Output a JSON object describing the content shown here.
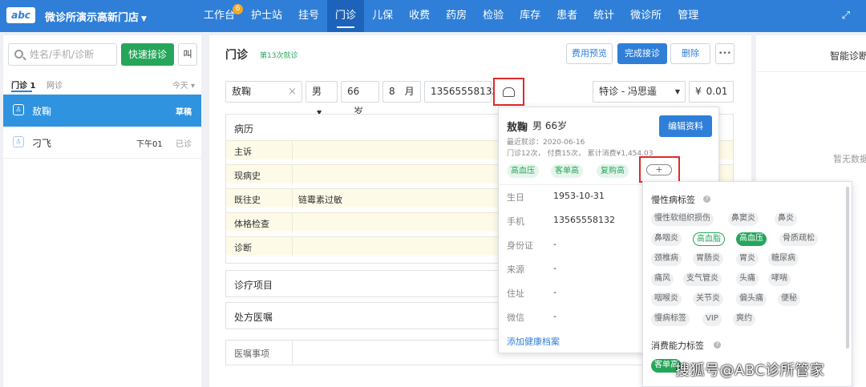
{
  "topbar": {
    "logo": "abc",
    "clinic_name": "微诊所演示高新门店",
    "nav": [
      {
        "label": "工作台",
        "badge": "6"
      },
      {
        "label": "护士站"
      },
      {
        "label": "挂号"
      },
      {
        "label": "门诊",
        "active": true
      },
      {
        "label": "儿保"
      },
      {
        "label": "收费"
      },
      {
        "label": "药房"
      },
      {
        "label": "检验"
      },
      {
        "label": "库存"
      },
      {
        "label": "患者"
      },
      {
        "label": "统计"
      },
      {
        "label": "微诊所"
      },
      {
        "label": "管理"
      }
    ],
    "expand_icon": "expand-icon"
  },
  "left": {
    "search_placeholder": "姓名/手机/诊断",
    "quick_btn": "快速接诊",
    "call_btn": "叫",
    "tab_clinic": "门诊 1",
    "tab_online": "网诊",
    "today": "今天 ▾",
    "patients": [
      {
        "name": "敖鞠",
        "time": "",
        "status": "草稿",
        "selected": true
      },
      {
        "name": "刁飞",
        "time": "下午01",
        "status": "已诊"
      }
    ]
  },
  "main": {
    "title": "门诊",
    "subtitle": "第13次就诊",
    "btn_fee": "费用预览",
    "btn_done": "完成接诊",
    "btn_delete": "删除",
    "btn_more": "•••",
    "patient_name": "敖鞠",
    "gender": "男",
    "age_years": "66",
    "unit_years": "岁",
    "age_months": "8",
    "unit_months": "月",
    "phone": "13565558132",
    "doctor": "特诊 - 冯思遥",
    "fee_symbol": "¥",
    "fee": "0.01",
    "medical_record": {
      "title": "病历",
      "rows": [
        {
          "label": "主诉",
          "value": ""
        },
        {
          "label": "现病史",
          "value": ""
        },
        {
          "label": "既往史",
          "value": "链霉素过敏"
        },
        {
          "label": "体格检查",
          "value": ""
        },
        {
          "label": "诊断",
          "value": ""
        }
      ]
    },
    "treatment_title": "诊疗项目",
    "prescription_title": "处方医嘱",
    "advice_label": "医嘱事项"
  },
  "right": {
    "title": "智能诊断",
    "empty": "暂无数据"
  },
  "popup": {
    "name": "敖鞠",
    "gender_age": "男 66岁",
    "edit_btn": "编辑资料",
    "last_visit": "最近就诊：2020-06-16",
    "stats": "门诊12次，  付费15次，   累计消费¥1,454.03",
    "tags": [
      "高血压",
      "客单高",
      "复购高"
    ],
    "plus": "+",
    "fields": [
      {
        "label": "生日",
        "value": "1953-10-31"
      },
      {
        "label": "手机",
        "value": "13565558132"
      },
      {
        "label": "身份证",
        "value": "-"
      },
      {
        "label": "来源",
        "value": "-"
      },
      {
        "label": "住址",
        "value": "-"
      },
      {
        "label": "微信",
        "value": "-"
      }
    ],
    "add_record": "添加健康档案"
  },
  "tag_panel": {
    "chronic_title": "慢性病标签",
    "chronic_tags": [
      {
        "label": "慢性软组织损伤"
      },
      {
        "label": "鼻窦炎"
      },
      {
        "label": "鼻炎"
      },
      {
        "label": "鼻咽炎"
      },
      {
        "label": "高血脂",
        "state": "outline"
      },
      {
        "label": "高血压",
        "state": "filled"
      },
      {
        "label": "骨质疏松"
      },
      {
        "label": "颈椎病"
      },
      {
        "label": "胃肠炎"
      },
      {
        "label": "胃炎"
      },
      {
        "label": "糖尿病"
      },
      {
        "label": "痛风"
      },
      {
        "label": "支气管炎"
      },
      {
        "label": "头痛"
      },
      {
        "label": "哮喘"
      },
      {
        "label": "咽喉炎"
      },
      {
        "label": "关节炎"
      },
      {
        "label": "偏头痛"
      },
      {
        "label": "便秘"
      },
      {
        "label": "慢病标签"
      },
      {
        "label": "VIP"
      },
      {
        "label": "爽约"
      }
    ],
    "consume_title": "消费能力标签",
    "consume_tags": [
      {
        "label": "客单高",
        "state": "filled"
      }
    ]
  },
  "watermark": "搜狐号@ABC诊所管家"
}
